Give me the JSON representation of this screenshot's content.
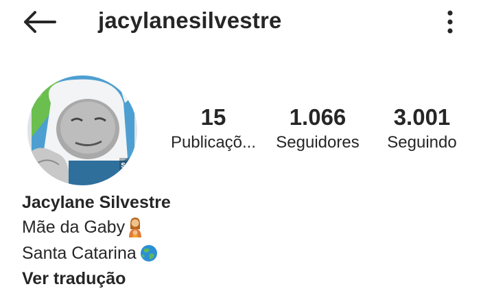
{
  "header": {
    "username": "jacylanesilvestre",
    "back_icon": "arrow-left-icon",
    "more_icon": "vertical-ellipsis-icon"
  },
  "profile": {
    "avatar_overlay_text": "se",
    "stats": [
      {
        "value": "15",
        "label": "Publicaçõ..."
      },
      {
        "value": "1.066",
        "label": "Seguidores"
      },
      {
        "value": "3.001",
        "label": "Seguindo"
      }
    ],
    "full_name": "Jacylane Silvestre",
    "bio_lines": [
      {
        "text": "Mãe da Gaby",
        "emoji": "mother-child-emoji"
      },
      {
        "text": "Santa Catarina",
        "emoji": "globe-emoji"
      }
    ],
    "translate_link": "Ver tradução"
  },
  "colors": {
    "text": "#262626",
    "background": "#ffffff"
  }
}
